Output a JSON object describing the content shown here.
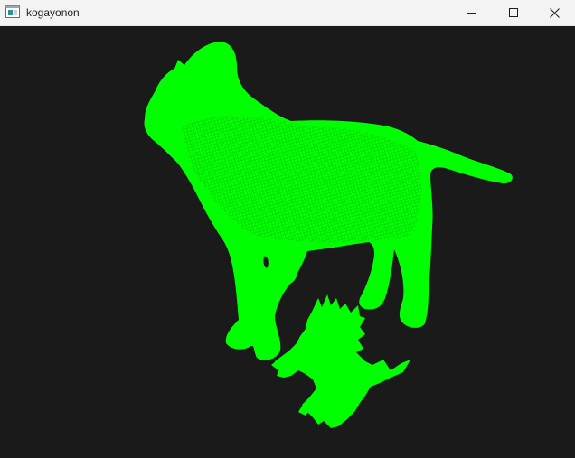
{
  "window": {
    "title": "kogayonon",
    "icon": "app-window-icon",
    "controls": [
      "minimize-icon",
      "maximize-icon",
      "close-icon"
    ]
  },
  "viewport": {
    "background": "#1a1a1a",
    "mesh_color": "#00ff00",
    "render_mode": "wireframe",
    "models": [
      "cat-model",
      "creature-model"
    ]
  }
}
